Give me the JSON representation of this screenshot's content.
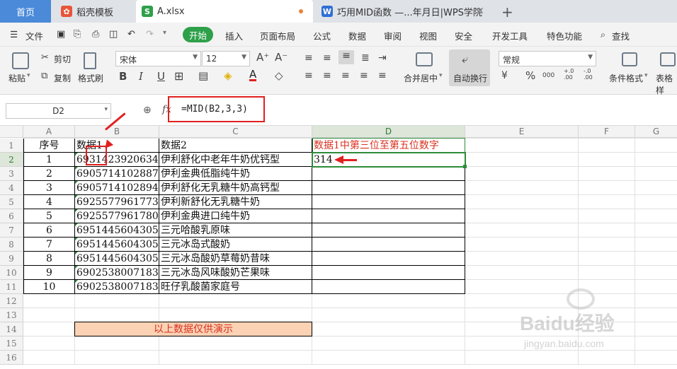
{
  "tabs": {
    "home": "首页",
    "daoke": "稻壳模板",
    "file": "A.xlsx",
    "file_icon": "S",
    "wps": "巧用MID函数 —...年月日|WPS学院",
    "wps_icon": "W",
    "add": "+"
  },
  "menu": {
    "file": "文件",
    "items": [
      "开始",
      "插入",
      "页面布局",
      "公式",
      "数据",
      "审阅",
      "视图",
      "安全",
      "开发工具",
      "特色功能"
    ],
    "search": "查找"
  },
  "ribbon": {
    "paste": "粘贴",
    "cut": "剪切",
    "copy": "复制",
    "format_painter": "格式刷",
    "font": "宋体",
    "size": "12",
    "merge": "合并居中",
    "wrap": "自动换行",
    "numfmt": "常规",
    "cond": "条件格式",
    "table": "表格样",
    "bold": "B",
    "italic": "I",
    "underline": "U",
    "font_grow": "A⁺",
    "font_shrink": "A⁻",
    "percent": "%",
    "thousands": "000",
    "inc_dec": "+.0 .00",
    "dec_dec": "-.0 .00",
    "currency": "¥"
  },
  "formula_bar": {
    "cell_ref": "D2",
    "fx": "fx",
    "formula": "=MID(B2,3,3)"
  },
  "columns": [
    "A",
    "B",
    "C",
    "D",
    "E",
    "F",
    "G"
  ],
  "rows": [
    "1",
    "2",
    "3",
    "4",
    "5",
    "6",
    "7",
    "8",
    "9",
    "10",
    "11",
    "12",
    "13",
    "14",
    "15",
    "16"
  ],
  "header": [
    "序号",
    "数据1",
    "数据2",
    "数据1中第三位至第五位数字"
  ],
  "data": [
    [
      "1",
      "6931423920634",
      "伊利舒化中老年牛奶优钙型",
      "314"
    ],
    [
      "2",
      "6905714102887",
      "伊利金典低脂纯牛奶",
      ""
    ],
    [
      "3",
      "6905714102894",
      "伊利舒化无乳糖牛奶高钙型",
      ""
    ],
    [
      "4",
      "6925577961773",
      "伊利新舒化无乳糖牛奶",
      ""
    ],
    [
      "5",
      "6925577961780",
      "伊利金典进口纯牛奶",
      ""
    ],
    [
      "6",
      "6951445604305",
      "三元哈酸乳原味",
      ""
    ],
    [
      "7",
      "6951445604305",
      "三元冰岛式酸奶",
      ""
    ],
    [
      "8",
      "6951445604305",
      "三元冰岛酸奶草莓奶昔味",
      ""
    ],
    [
      "9",
      "6902538007183",
      "三元冰岛风味酸奶芒果味",
      ""
    ],
    [
      "10",
      "6902538007183",
      "旺仔乳酸菌家庭号",
      ""
    ]
  ],
  "note": "以上数据仅供演示",
  "watermark": "Baidu经验",
  "watermark_url": "jingyan.baidu.com",
  "colors": {
    "accent": "#2ea04a",
    "red": "#e02020",
    "note_bg": "#fbd2b4",
    "note_text": "#d9301f"
  }
}
